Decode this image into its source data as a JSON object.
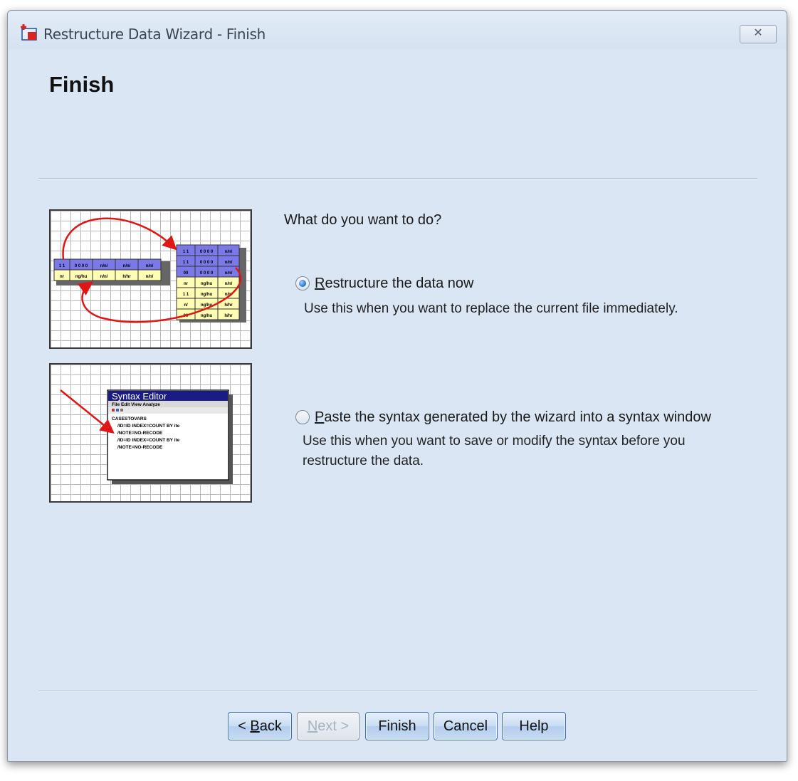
{
  "window": {
    "title": "Restructure Data Wizard - Finish",
    "close_glyph": "✕"
  },
  "page": {
    "heading": "Finish",
    "question": "What do you want to do?"
  },
  "options": [
    {
      "label_first": "R",
      "label_rest": "estructure the data now",
      "description": "Use this when you want to replace the current file immediately.",
      "selected": true
    },
    {
      "label_first": "P",
      "label_rest": "aste the syntax generated by the wizard into a syntax window",
      "description": "Use this when you want to save or modify the syntax before you restructure the data.",
      "selected": false
    }
  ],
  "illustration_top": {
    "wide_header": [
      "1 1",
      "0 0 0 0",
      "n/n/",
      "n/n/",
      "n/n/"
    ],
    "wide_row": [
      "nr",
      "ng/hu",
      "n/n/",
      "h/hr",
      "n/n/"
    ],
    "long_rows": [
      [
        "1 1",
        "0 0 0 0",
        "n/n/"
      ],
      [
        "1 1",
        "0 0 0 0",
        "n/n/"
      ],
      [
        "00",
        "0 0 0 0",
        "n/n/"
      ],
      [
        "nr",
        "ng/hu",
        "n/n/"
      ],
      [
        "1 1",
        "ng/hu",
        "n/n/"
      ],
      [
        "n/",
        "ng/hu",
        "h/hr"
      ],
      [
        "00",
        "ng/hu",
        "h/hr"
      ]
    ]
  },
  "illustration_bottom": {
    "title": "Syntax Editor",
    "menu": "File Edit View Analyze",
    "lines": [
      "CASESTOVARS",
      "/ID=ID INDEX=COUNT BY ite",
      "/NOTE=NO-RECODE",
      "/ID=ID INDEX=COUNT BY ite",
      "/NOTE=NO-RECODE"
    ]
  },
  "buttons": {
    "back_prefix": "< ",
    "back_access": "B",
    "back_rest": "ack",
    "next_access": "N",
    "next_rest": "ext >",
    "finish": "Finish",
    "cancel": "Cancel",
    "help": "Help"
  },
  "colors": {
    "dialog_bg": "#dbe6f4",
    "table_header": "#7b78e8",
    "table_row": "#fffcb4",
    "arrow": "#e01515",
    "editor_title": "#1b1b86"
  }
}
